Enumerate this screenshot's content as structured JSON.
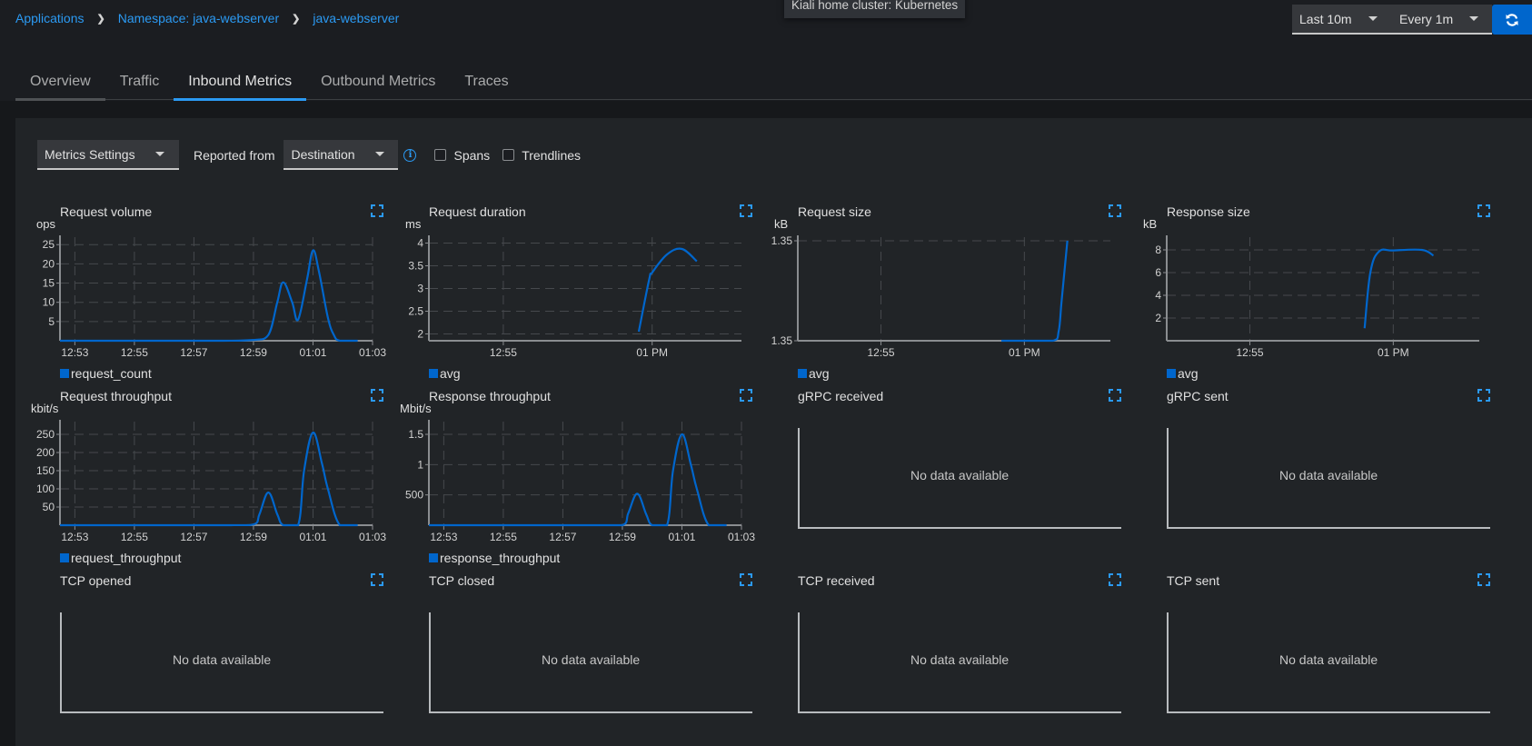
{
  "breadcrumb": [
    {
      "label": "Applications"
    },
    {
      "label": "Namespace: java-webserver"
    },
    {
      "label": "java-webserver"
    }
  ],
  "tooltip": "Kiali home cluster: Kubernetes",
  "time_controls": {
    "range": "Last 10m",
    "refresh_interval": "Every 1m"
  },
  "tabs": [
    {
      "label": "Overview",
      "active": false
    },
    {
      "label": "Traffic",
      "active": false
    },
    {
      "label": "Inbound Metrics",
      "active": true
    },
    {
      "label": "Outbound Metrics",
      "active": false
    },
    {
      "label": "Traces",
      "active": false
    }
  ],
  "toolbar": {
    "metrics_settings": "Metrics Settings",
    "reported_from_label": "Reported from",
    "reported_from_value": "Destination",
    "spans_label": "Spans",
    "spans_checked": false,
    "trendlines_label": "Trendlines",
    "trendlines_checked": false
  },
  "colors": {
    "accent": "#2b9af3",
    "series": "#0066cc",
    "refresh_button": "#0066cc"
  },
  "no_data_text": "No data available",
  "chart_data": [
    {
      "id": "request-volume",
      "type": "line",
      "title": "Request volume",
      "ylabel": "ops",
      "legend": "request_count",
      "x_ticks": [
        "12:53",
        "12:55",
        "12:57",
        "12:59",
        "01:01",
        "01:03"
      ],
      "x_range": [
        12.5,
        22.5
      ],
      "x_tick_pos": [
        13,
        15,
        17,
        19,
        21,
        23
      ],
      "y_ticks": [
        5,
        10,
        15,
        20,
        25
      ],
      "ylim": [
        0,
        26
      ],
      "x": [
        12.5,
        14,
        16,
        18,
        19,
        19.5,
        19.8,
        20,
        20.3,
        20.5,
        20.8,
        21,
        21.2,
        21.5,
        21.7,
        21.9,
        22.5
      ],
      "values": [
        0,
        0,
        0,
        0,
        0.2,
        1.5,
        10,
        15.2,
        10,
        5.5,
        16,
        23.5,
        18,
        6,
        1.5,
        0,
        0
      ]
    },
    {
      "id": "request-duration",
      "type": "line",
      "title": "Request duration",
      "ylabel": "ms",
      "legend": "avg",
      "x_ticks": [
        "12:55",
        "01 PM"
      ],
      "x_range": [
        12.5,
        23
      ],
      "x_tick_pos": [
        15,
        20
      ],
      "y_ticks": [
        2,
        2.5,
        3,
        3.5,
        4
      ],
      "y_tick_labels": [
        "2",
        "2.5",
        "3",
        "3.5",
        "4"
      ],
      "ylim": [
        1.85,
        4.05
      ],
      "x": [
        19.55,
        19.9,
        20.0,
        20.5,
        21.0,
        21.5
      ],
      "values": [
        2.05,
        3.2,
        3.35,
        3.75,
        3.87,
        3.6
      ]
    },
    {
      "id": "request-size",
      "type": "line",
      "title": "Request size",
      "ylabel": "kB",
      "legend": "avg",
      "x_ticks": [
        "12:55",
        "01 PM"
      ],
      "x_range": [
        12.1,
        23
      ],
      "x_tick_pos": [
        15,
        20
      ],
      "y_ticks": [
        0,
        1
      ],
      "y_tick_labels": [
        "1.35",
        "1.35"
      ],
      "ylim": [
        0,
        1
      ],
      "x": [
        19.2,
        20,
        21.0,
        21.2,
        21.3,
        21.5
      ],
      "values": [
        0,
        0,
        0,
        0.1,
        0.4,
        1
      ]
    },
    {
      "id": "response-size",
      "type": "line",
      "title": "Response size",
      "ylabel": "kB",
      "legend": "avg",
      "x_ticks": [
        "12:55",
        "01 PM"
      ],
      "x_range": [
        12.1,
        23
      ],
      "x_tick_pos": [
        15,
        20
      ],
      "y_ticks": [
        2,
        4,
        6,
        8
      ],
      "ylim": [
        0,
        8.8
      ],
      "x": [
        19.0,
        19.2,
        19.5,
        20.0,
        21.0,
        21.4
      ],
      "values": [
        1.1,
        6.0,
        7.85,
        7.95,
        8.0,
        7.5
      ]
    },
    {
      "id": "request-throughput",
      "type": "line",
      "title": "Request throughput",
      "ylabel": "kbit/s",
      "legend": "request_throughput",
      "x_ticks": [
        "12:53",
        "12:55",
        "12:57",
        "12:59",
        "01:01",
        "01:03"
      ],
      "x_range": [
        12.5,
        22.5
      ],
      "x_tick_pos": [
        13,
        15,
        17,
        19,
        21,
        23
      ],
      "y_ticks": [
        50,
        100,
        150,
        200,
        250
      ],
      "ylim": [
        0,
        275
      ],
      "x": [
        12.5,
        18,
        19,
        19.2,
        19.5,
        19.8,
        20,
        20.5,
        20.7,
        21,
        21.3,
        21.5,
        21.9,
        22.5
      ],
      "values": [
        0,
        0,
        2,
        30,
        90,
        30,
        0,
        0,
        150,
        255,
        170,
        100,
        0,
        0
      ]
    },
    {
      "id": "response-throughput",
      "type": "line",
      "title": "Response throughput",
      "ylabel": "Mbit/s",
      "legend": "response_throughput",
      "x_ticks": [
        "12:53",
        "12:55",
        "12:57",
        "12:59",
        "01:01",
        "01:03"
      ],
      "x_range": [
        12.5,
        22.5
      ],
      "x_tick_pos": [
        13,
        15,
        17,
        19,
        21,
        23
      ],
      "y_ticks": [
        0.5,
        1,
        1.5
      ],
      "y_tick_labels": [
        "500",
        "1",
        "1.5"
      ],
      "ylim": [
        0,
        1.65
      ],
      "x": [
        12.5,
        18,
        19,
        19.2,
        19.5,
        19.8,
        20,
        20.5,
        20.7,
        21,
        21.3,
        21.5,
        21.9,
        22.5
      ],
      "values": [
        0,
        0,
        0,
        0.2,
        0.52,
        0.18,
        0,
        0,
        0.9,
        1.5,
        1.0,
        0.6,
        0,
        0
      ]
    }
  ],
  "empty_charts": [
    {
      "id": "grpc-received",
      "title": "gRPC received"
    },
    {
      "id": "grpc-sent",
      "title": "gRPC sent"
    },
    {
      "id": "tcp-opened",
      "title": "TCP opened"
    },
    {
      "id": "tcp-closed",
      "title": "TCP closed"
    },
    {
      "id": "tcp-received",
      "title": "TCP received"
    },
    {
      "id": "tcp-sent",
      "title": "TCP sent"
    }
  ]
}
